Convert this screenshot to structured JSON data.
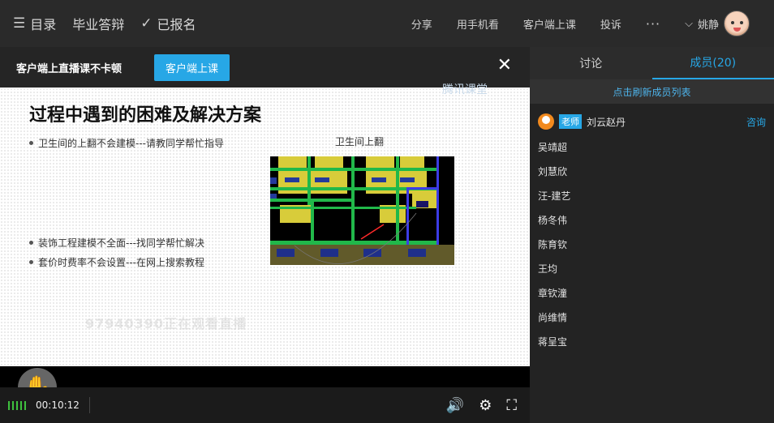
{
  "topbar": {
    "menu_label": "目录",
    "course_label": "毕业答辩",
    "enrolled_label": "已报名",
    "share": "分享",
    "mobile": "用手机看",
    "client": "客户端上课",
    "complain": "投诉",
    "more": "···",
    "username": "姚静"
  },
  "notice": {
    "text": "客户端上直播课不卡顿",
    "button": "客户端上课",
    "close": "✕"
  },
  "slide": {
    "title": "过程中遇到的困难及解决方案",
    "logo_text": "腾讯课堂",
    "bullets": [
      "卫生间的上翻不会建模---请教同学帮忙指导",
      "装饰工程建模不全面---找同学帮忙解决",
      "套价时费率不会设置---在网上搜索教程"
    ],
    "image_caption": "卫生间上翻",
    "watermark": "97940390正在观看直播"
  },
  "controls": {
    "time": "00:10:12"
  },
  "side": {
    "tabs": [
      {
        "label": "讨论"
      },
      {
        "label": "成员(20)"
      }
    ],
    "refresh": "点击刷新成员列表",
    "teacher": {
      "badge": "老师",
      "name": "刘云赵丹",
      "action": "咨询"
    },
    "members": [
      "吴靖超",
      "刘慧欣",
      "汪-建艺",
      "杨冬伟",
      "陈育钦",
      "王均",
      "章钦潼",
      "尚维情",
      "蒋呈宝"
    ]
  },
  "colors": {
    "accent": "#27a7e6",
    "signal": "#3ec03e"
  }
}
